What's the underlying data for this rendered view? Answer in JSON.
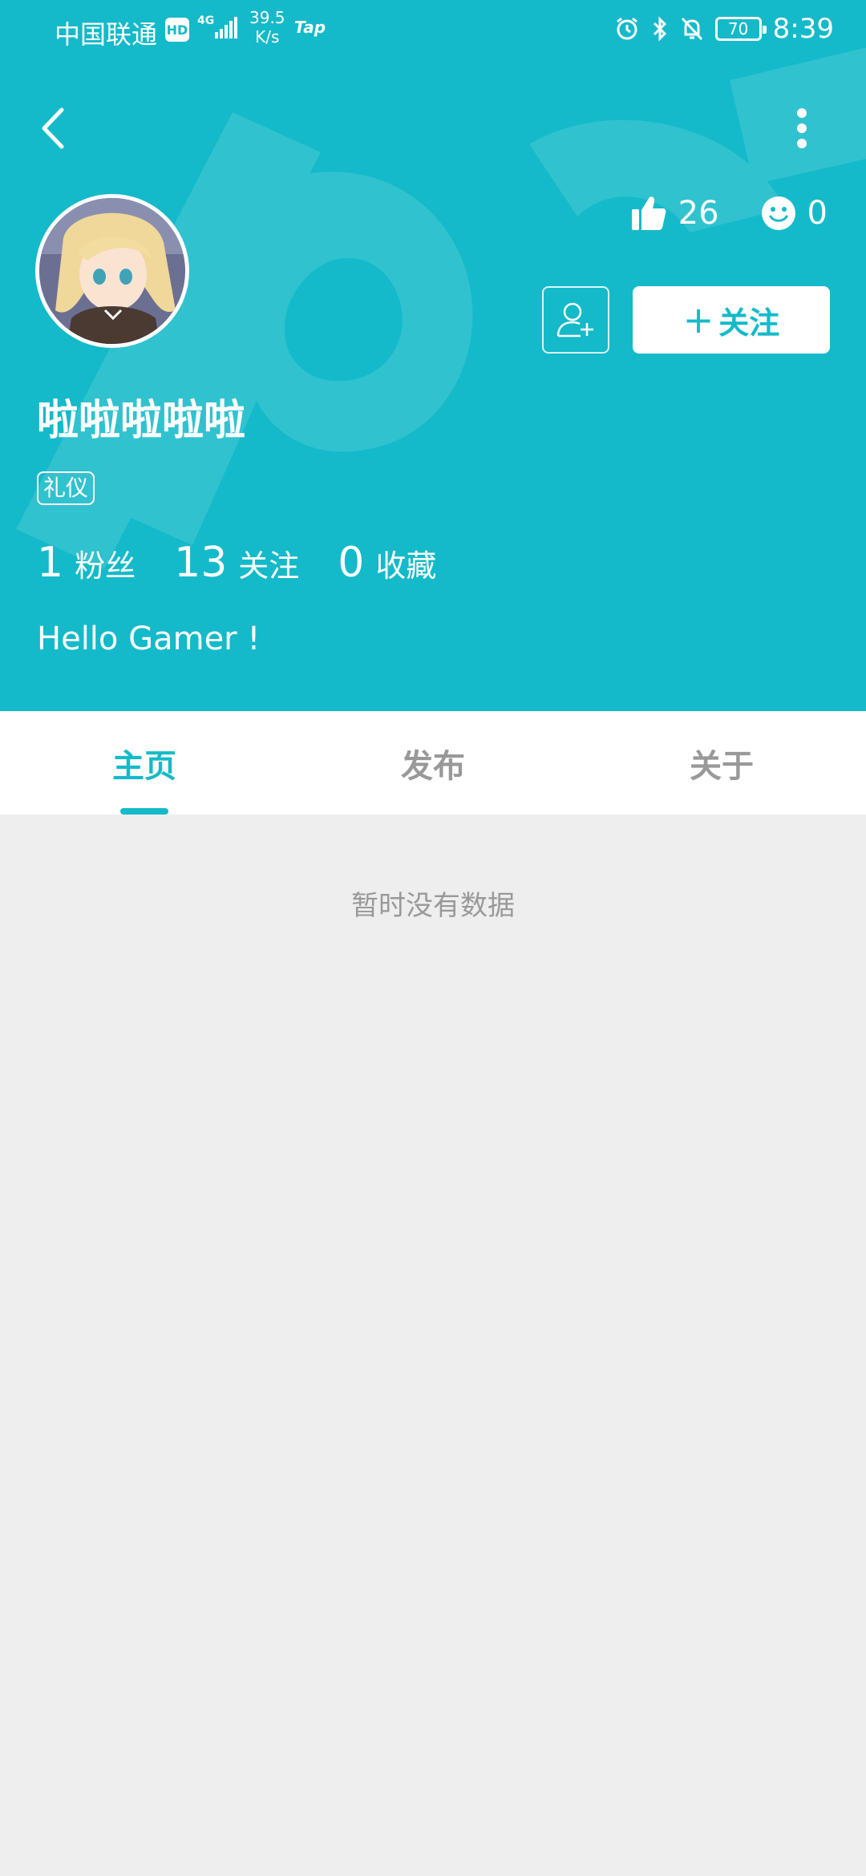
{
  "status_bar": {
    "carrier": "中国联通",
    "hd": "HD",
    "network": "4G",
    "speed_value": "39.5",
    "speed_unit": "K/s",
    "app_indicator": "Tap",
    "battery": "70",
    "time": "8:39"
  },
  "profile": {
    "username": "啦啦啦啦啦",
    "tag": "礼仪",
    "bio": "Hello Gamer !",
    "likes": "26",
    "reactions": "0",
    "follow_label": "关注",
    "follow_plus": "+",
    "counts": [
      {
        "value": "1",
        "label": "粉丝"
      },
      {
        "value": "13",
        "label": "关注"
      },
      {
        "value": "0",
        "label": "收藏"
      }
    ]
  },
  "tabs": [
    {
      "label": "主页",
      "active": true
    },
    {
      "label": "发布",
      "active": false
    },
    {
      "label": "关于",
      "active": false
    }
  ],
  "content": {
    "empty_message": "暂时没有数据"
  },
  "colors": {
    "accent": "#14bac9",
    "background": "#eeeeee",
    "tab_inactive": "#999999"
  },
  "icons": {
    "back": "back-arrow-icon",
    "more": "more-vertical-icon",
    "likes": "thumbs-up-icon",
    "reactions": "smiley-icon",
    "add_friend": "add-user-icon"
  }
}
